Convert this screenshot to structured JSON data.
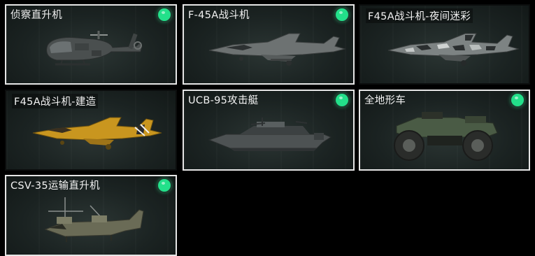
{
  "vehicles": [
    {
      "name": "侦察直升机",
      "icon": "scout-helicopter-icon",
      "selected": true,
      "status": "available"
    },
    {
      "name": "F-45A战斗机",
      "icon": "fighter-jet-icon",
      "selected": true,
      "status": "available"
    },
    {
      "name": "F45A战斗机-夜间迷彩",
      "icon": "fighter-jet-night-camo-icon",
      "selected": false,
      "status": ""
    },
    {
      "name": "F45A战斗机-建造",
      "icon": "fighter-jet-construction-icon",
      "selected": false,
      "status": ""
    },
    {
      "name": "UCB-95攻击艇",
      "icon": "attack-boat-icon",
      "selected": true,
      "status": "available"
    },
    {
      "name": "全地形车",
      "icon": "atv-icon",
      "selected": true,
      "status": "available"
    },
    {
      "name": "CSV-35运输直升机",
      "icon": "tiltrotor-transport-icon",
      "selected": true,
      "status": "available"
    }
  ],
  "colors": {
    "status_dot": "#23e08a",
    "selected_border": "#e6e6e6",
    "card_bg": "#1b2322",
    "text": "#f2f2f2"
  }
}
